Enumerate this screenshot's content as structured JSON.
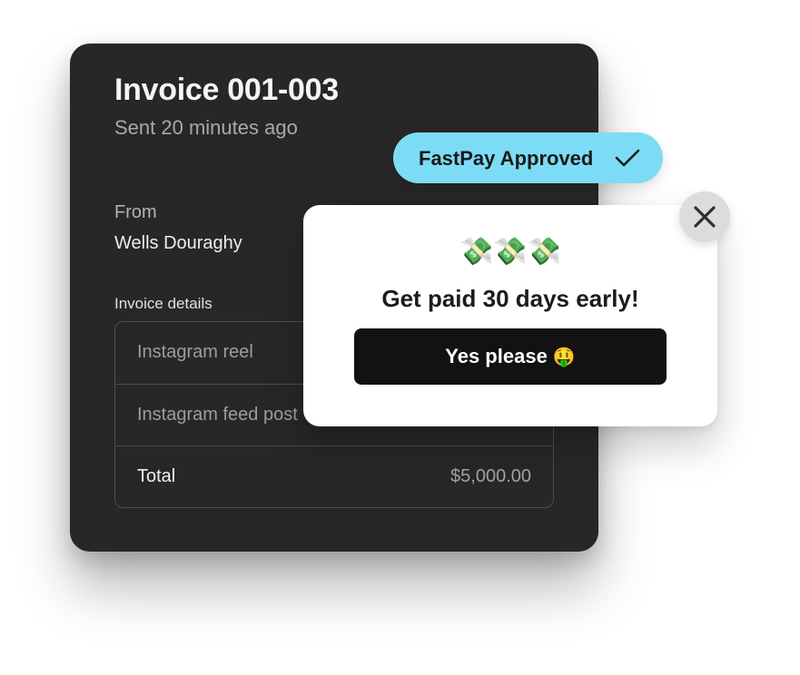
{
  "invoice": {
    "title": "Invoice 001-003",
    "sent": "Sent 20 minutes ago",
    "from_label": "From",
    "from_name": "Wells Douraghy",
    "details_label": "Invoice details",
    "items": [
      "Instagram reel",
      "Instagram feed post"
    ],
    "total_label": "Total",
    "total_amount": "$5,000.00"
  },
  "badge": {
    "label": "FastPay Approved",
    "icon": "checkmark-icon",
    "color": "#7ddcf5"
  },
  "popup": {
    "emojis": "💸💸💸",
    "title": "Get paid 30 days early!",
    "cta_label": "Yes please",
    "cta_emoji": "🤑",
    "close_icon": "close-icon"
  },
  "colors": {
    "card_bg": "#272727",
    "cta_bg": "#121212",
    "close_bg": "#dcdcdc"
  }
}
